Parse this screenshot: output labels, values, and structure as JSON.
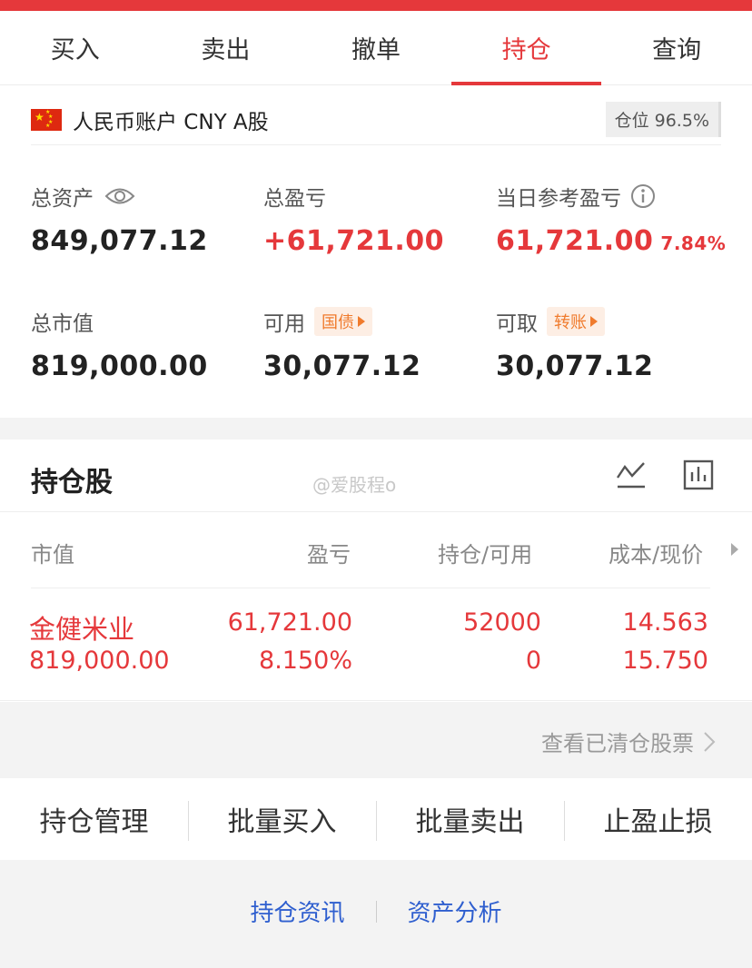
{
  "tabs": [
    {
      "label": "买入"
    },
    {
      "label": "卖出"
    },
    {
      "label": "撤单"
    },
    {
      "label": "持仓",
      "active": true
    },
    {
      "label": "查询"
    }
  ],
  "account": {
    "label": "人民币账户 CNY A股",
    "flag_icon": "china-flag-icon",
    "position_label": "仓位 96.5%"
  },
  "summary": {
    "total_assets": {
      "label": "总资产",
      "value": "849,077.12",
      "icon": "eye-icon"
    },
    "total_pnl": {
      "label": "总盈亏",
      "value": "+61,721.00"
    },
    "daily_pnl": {
      "label": "当日参考盈亏",
      "value": "61,721.00",
      "pct": "7.84%",
      "icon": "info-icon"
    },
    "market_value": {
      "label": "总市值",
      "value": "819,000.00"
    },
    "available": {
      "label": "可用",
      "value": "30,077.12",
      "pill": "国债"
    },
    "withdrawable": {
      "label": "可取",
      "value": "30,077.12",
      "pill": "转账"
    }
  },
  "holdings": {
    "title": "持仓股",
    "watermark": "@爱股程o",
    "columns": [
      "市值",
      "盈亏",
      "持仓/可用",
      "成本/现价"
    ],
    "rows": [
      {
        "name": "金健米业",
        "market_value": "819,000.00",
        "pnl": "61,721.00",
        "pnl_pct": "8.150%",
        "position": "52000",
        "available": "0",
        "cost": "14.563",
        "price": "15.750"
      }
    ],
    "cleared_link": "查看已清仓股票"
  },
  "actions": [
    "持仓管理",
    "批量买入",
    "批量卖出",
    "止盈止损"
  ],
  "bottom_links": [
    "持仓资讯",
    "资产分析"
  ],
  "colors": {
    "accent": "#e5383b",
    "link": "#2f5fcf",
    "pill": "#f07b2d"
  }
}
